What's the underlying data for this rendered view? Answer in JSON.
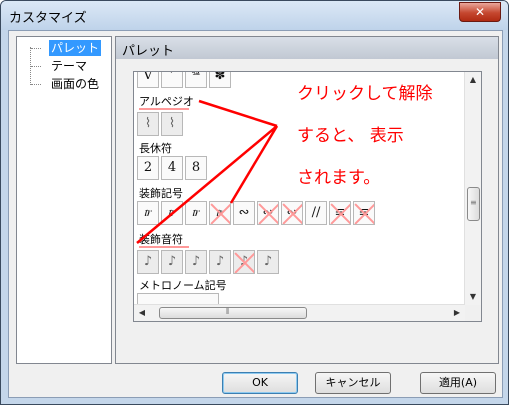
{
  "window": {
    "title": "カスタマイズ",
    "close_glyph": "✕"
  },
  "tree": {
    "items": [
      {
        "label": "パレット",
        "selected": true
      },
      {
        "label": "テーマ",
        "selected": false
      },
      {
        "label": "画面の色",
        "selected": false
      }
    ]
  },
  "pane": {
    "title": "パレット"
  },
  "palette": {
    "sections": [
      {
        "label": "アルペジオ"
      },
      {
        "label": "長休符"
      },
      {
        "label": "装飾記号"
      },
      {
        "label": "装飾音符"
      },
      {
        "label": "メトロノーム記号"
      }
    ],
    "rows": {
      "top": [
        {
          "glyph": "V"
        },
        {
          "glyph": "’"
        },
        {
          "glyph": "𝆮"
        },
        {
          "glyph": "✽"
        }
      ],
      "arpeggio": [
        {
          "glyph": "⌇"
        },
        {
          "glyph": "⌇"
        }
      ],
      "long_rest": [
        {
          "glyph": "2"
        },
        {
          "glyph": "4"
        },
        {
          "glyph": "8"
        }
      ],
      "ornaments": [
        {
          "glyph": "𝆖"
        },
        {
          "glyph": "𝆖"
        },
        {
          "glyph": "𝆖"
        },
        {
          "glyph": "𝆖"
        },
        {
          "glyph": "∾"
        },
        {
          "glyph": "∾"
        },
        {
          "glyph": "∾"
        },
        {
          "glyph": "∕∕"
        },
        {
          "glyph": "≡"
        },
        {
          "glyph": "≡"
        }
      ],
      "grace": [
        {
          "glyph": "♪"
        },
        {
          "glyph": "♪"
        },
        {
          "glyph": "♪"
        },
        {
          "glyph": "♪"
        },
        {
          "glyph": "♪"
        },
        {
          "glyph": "♪"
        }
      ]
    }
  },
  "annotation": {
    "line1": "クリックして解除",
    "line2": "すると、 表示",
    "line3": "されます。"
  },
  "buttons": {
    "ok": "OK",
    "cancel": "キャンセル",
    "apply": "適用(A)"
  },
  "colors": {
    "annotation": "#ff0000",
    "selection": "#3399ff"
  }
}
